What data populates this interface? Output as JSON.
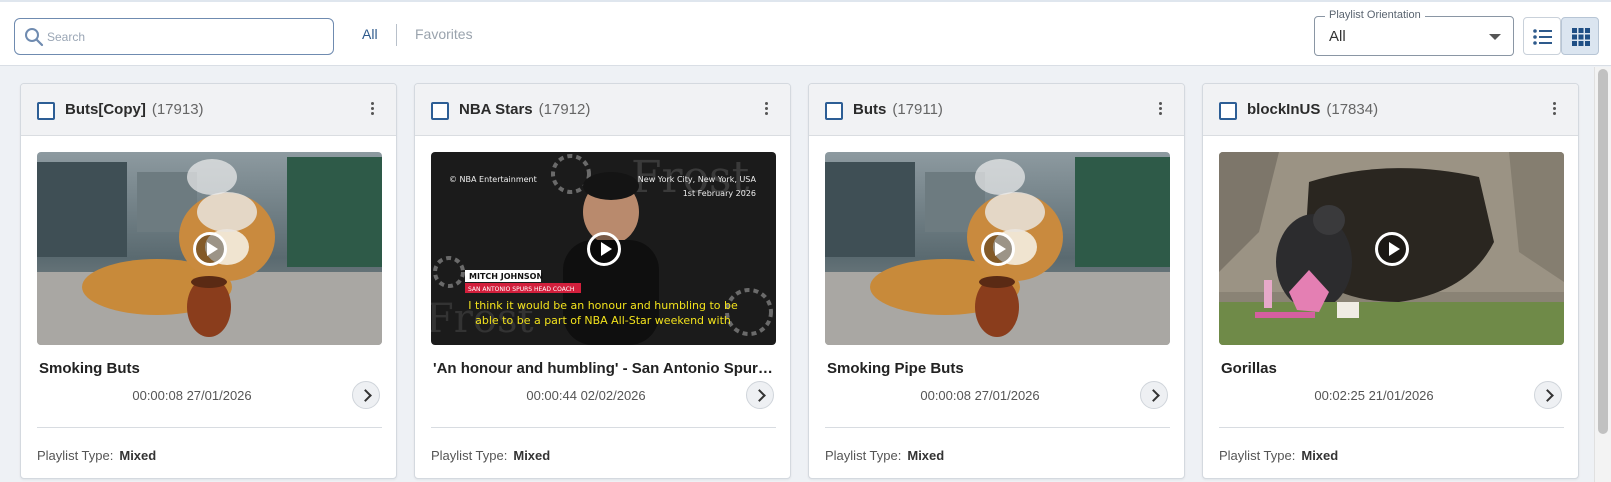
{
  "search": {
    "placeholder": "Search",
    "value": ""
  },
  "filter_tabs": {
    "all": "All",
    "favorites": "Favorites"
  },
  "orientation": {
    "label": "Playlist Orientation",
    "value": "All"
  },
  "colors": {
    "accent": "#2e5a8c",
    "checkbox": "#2d5e95",
    "active_view_bg": "#dbe5f0"
  },
  "playlists": [
    {
      "name": "Buts[Copy]",
      "id": "(17913)",
      "video_title": "Smoking Buts",
      "meta": "00:00:08 27/01/2026",
      "type_label": "Playlist Type:",
      "type_value": "Mixed",
      "thumbnail": "dog-smoking-pipe"
    },
    {
      "name": "NBA Stars",
      "id": "(17912)",
      "video_title": "'An honour and humbling' - San Antonio Spurs' Mitch Johnson",
      "meta": "00:00:44 02/02/2026",
      "type_label": "Playlist Type:",
      "type_value": "Mixed",
      "thumbnail": "press-conference",
      "overlay": {
        "brand": "© NBA Entertainment",
        "location": "New York City, New York, USA",
        "date": "1st February 2026",
        "name": "MITCH JOHNSON",
        "role": "SAN ANTONIO SPURS HEAD COACH",
        "caption_1": "I think it would be an honour and humbling to be",
        "caption_2": "able to be a part of NBA All-Star weekend with"
      }
    },
    {
      "name": "Buts",
      "id": "(17911)",
      "video_title": "Smoking Pipe Buts",
      "meta": "00:00:08 27/01/2026",
      "type_label": "Playlist Type:",
      "type_value": "Mixed",
      "thumbnail": "dog-smoking-pipe"
    },
    {
      "name": "blockInUS",
      "id": "(17834)",
      "video_title": "Gorillas",
      "meta": "00:02:25 21/01/2026",
      "type_label": "Playlist Type:",
      "type_value": "Mixed",
      "thumbnail": "gorilla-cave"
    }
  ]
}
